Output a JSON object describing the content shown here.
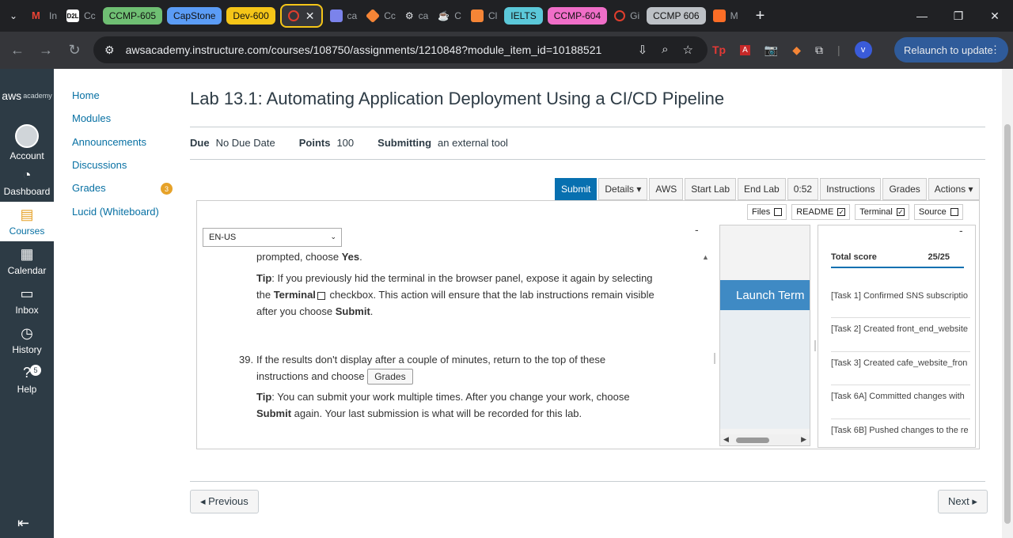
{
  "browser": {
    "tabs": [
      {
        "label": "In",
        "icon": "gmail-icon",
        "color": "#ea4335"
      },
      {
        "label": "Cc",
        "icon": "d2l-icon",
        "color": "#ffffff"
      },
      {
        "label": "CCMP-605",
        "pill": "#6fbf73"
      },
      {
        "label": "CapStone",
        "pill": "#5b9cf6"
      },
      {
        "label": "Dev-600",
        "pill": "#f5c518"
      },
      {
        "label": "ca",
        "icon": "calculator-icon",
        "color": "#7b83eb"
      },
      {
        "label": "Cc",
        "icon": "aws-cube-icon",
        "color": "#f58536"
      },
      {
        "label": "ca",
        "icon": "tools-icon",
        "color": "#e8eaed"
      },
      {
        "label": "C",
        "icon": "cup-icon",
        "color": "#e8eaed"
      },
      {
        "label": "Cl",
        "icon": "diagram-icon",
        "color": "#f58536"
      },
      {
        "label": "IELTS",
        "pill": "#5bc8d9"
      },
      {
        "label": "CCMP-604",
        "pill": "#f06ec8"
      },
      {
        "label": "Gi",
        "icon": "canvas-icon",
        "color": "#e03e2d"
      },
      {
        "label": "CCMP 606",
        "pill": "#bdc1c6"
      },
      {
        "label": "M",
        "icon": "gitlab-icon",
        "color": "#fc6d26"
      }
    ],
    "url": "awsacademy.instructure.com/courses/108750/assignments/1210848?module_item_id=10188521",
    "relaunch_label": "Relaunch to update",
    "profile_initial": "v"
  },
  "global_nav": {
    "logo": "aws",
    "logo_sub": "academy",
    "items": [
      {
        "label": "Account",
        "icon": "account-icon"
      },
      {
        "label": "Dashboard",
        "icon": "dashboard-icon"
      },
      {
        "label": "Courses",
        "icon": "courses-icon"
      },
      {
        "label": "Calendar",
        "icon": "calendar-icon"
      },
      {
        "label": "Inbox",
        "icon": "inbox-icon"
      },
      {
        "label": "History",
        "icon": "history-icon"
      },
      {
        "label": "Help",
        "icon": "help-icon",
        "badge": "5"
      }
    ]
  },
  "course_nav": {
    "items": [
      "Home",
      "Modules",
      "Announcements",
      "Discussions",
      "Grades",
      "Lucid (Whiteboard)"
    ],
    "grades_badge": "3"
  },
  "assignment": {
    "title": "Lab 13.1: Automating Application Deployment Using a CI/CD Pipeline",
    "due_label": "Due",
    "due_value": "No Due Date",
    "points_label": "Points",
    "points_value": "100",
    "submitting_label": "Submitting",
    "submitting_value": "an external tool"
  },
  "lab_toolbar": {
    "buttons": [
      "Submit",
      "Details ▾",
      "AWS",
      "Start Lab",
      "End Lab",
      "0:52",
      "Instructions",
      "Grades",
      "Actions ▾"
    ]
  },
  "panel_toggles": [
    {
      "label": "Files",
      "checked": false
    },
    {
      "label": "README",
      "checked": true
    },
    {
      "label": "Terminal",
      "checked": true
    },
    {
      "label": "Source",
      "checked": false
    }
  ],
  "language": "EN-US",
  "instructions": {
    "line1_pre": "prompted, choose ",
    "line1_b": "Yes",
    "line1_post": ".",
    "tip1_label": "Tip",
    "tip1_a": ": If you previously hid the terminal in the browser panel, expose it again by selecting the ",
    "tip1_b": "Terminal",
    "tip1_c": " checkbox. This action will ensure that the lab instructions remain visible after you choose ",
    "tip1_d": "Submit",
    "tip1_e": ".",
    "step_num": "39.",
    "step_text": "If the results don't display after a couple of minutes, return to the top of these instructions and choose",
    "step_btn": "Grades",
    "tip2_label": "Tip",
    "tip2_a": ": You can submit your work multiple times. After you change your work, choose ",
    "tip2_b": "Submit",
    "tip2_c": " again. Your last submission is what will be recorded for this lab."
  },
  "terminal": {
    "launch_label": "Launch Term"
  },
  "score": {
    "total_label": "Total score",
    "total_value": "25/25",
    "items": [
      "[Task 1] Confirmed SNS subscriptio",
      "[Task 2] Created front_end_website",
      "[Task 3] Created cafe_website_fron",
      "[Task 6A] Committed changes with",
      "[Task 6B] Pushed changes to the re"
    ]
  },
  "pager": {
    "previous": "◂ Previous",
    "next": "Next ▸"
  }
}
